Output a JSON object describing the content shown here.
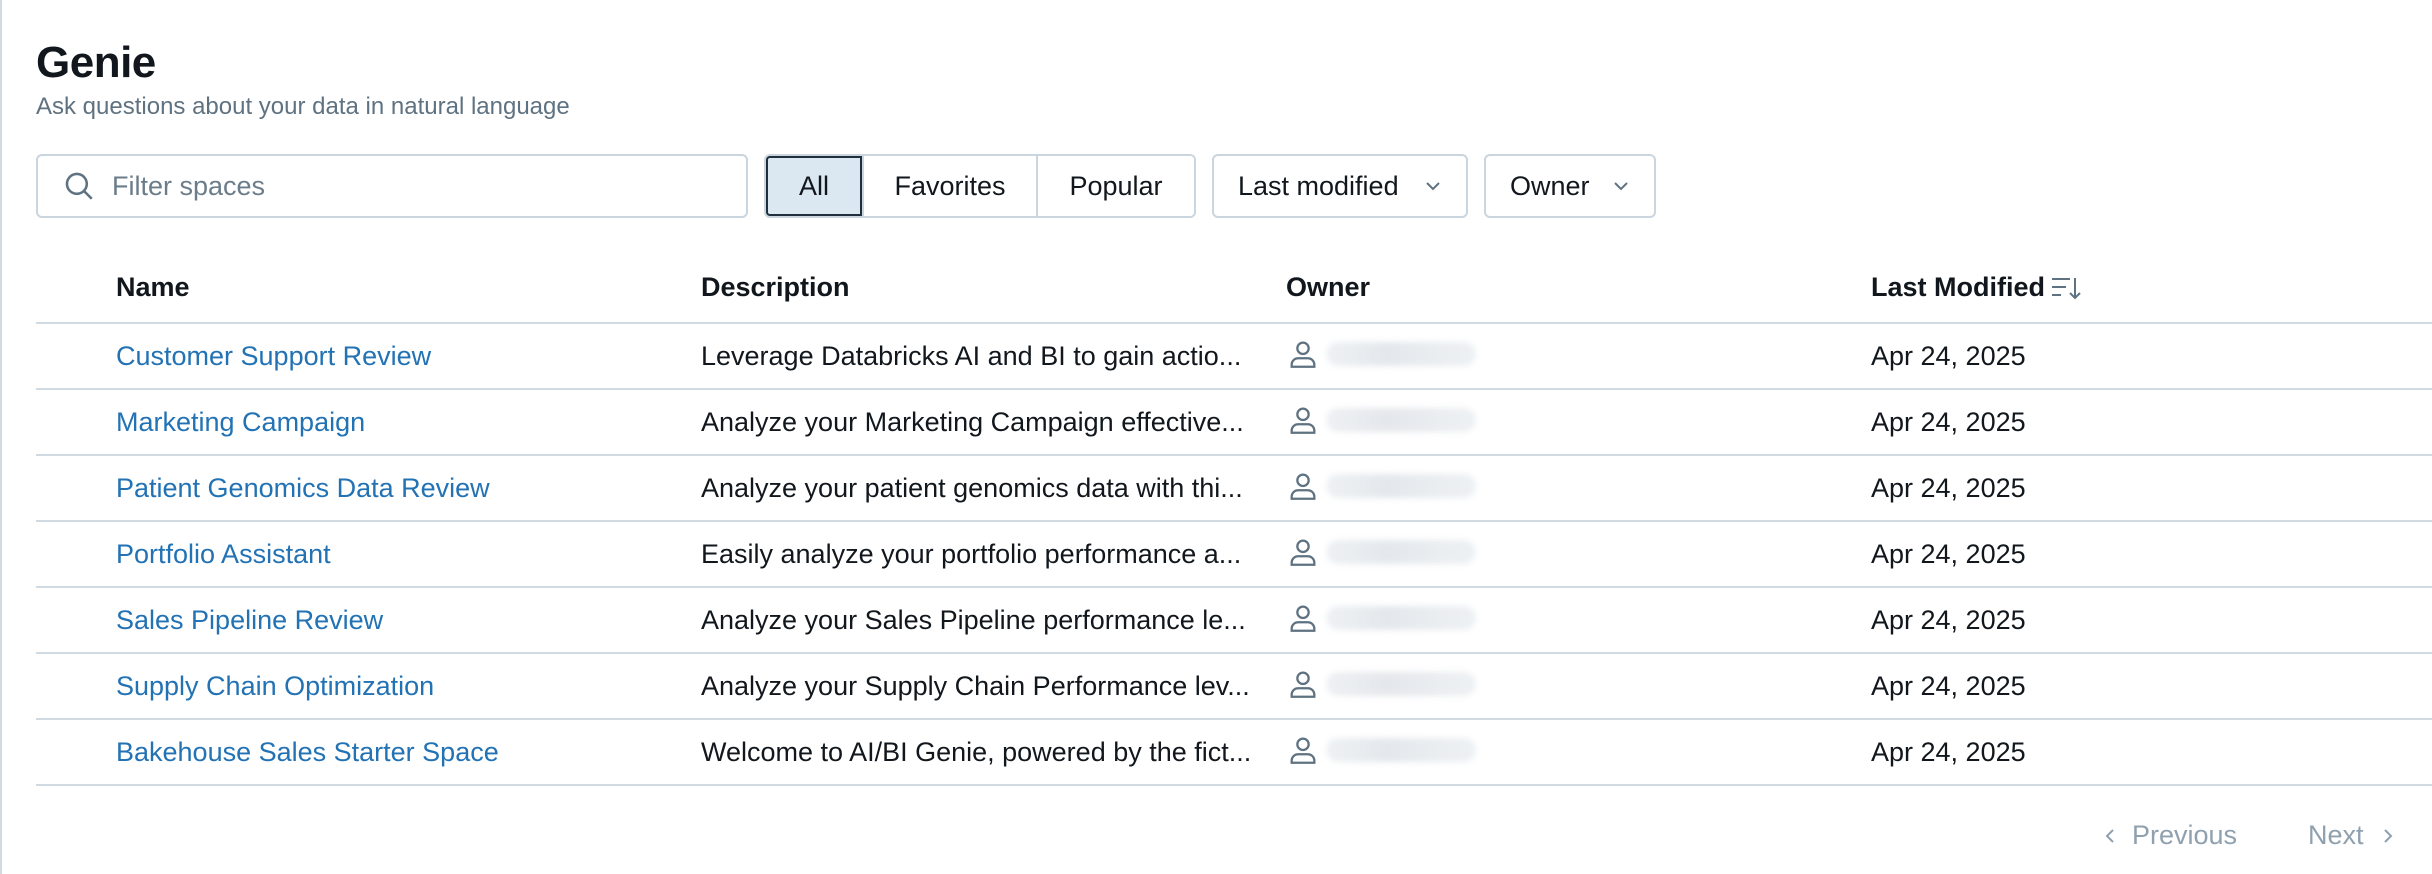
{
  "page": {
    "title": "Genie",
    "subtitle": "Ask questions about your data in natural language"
  },
  "toolbar": {
    "search_placeholder": "Filter spaces",
    "search_icon": "search-icon",
    "segments": [
      "All",
      "Favorites",
      "Popular"
    ],
    "active_segment": "All",
    "sort_dropdown": "Last modified",
    "owner_dropdown": "Owner"
  },
  "table": {
    "headers": {
      "name": "Name",
      "description": "Description",
      "owner": "Owner",
      "last_modified": "Last Modified"
    },
    "rows": [
      {
        "name": "Customer Support Review",
        "description": "Leverage Databricks AI and BI to gain actio...",
        "last_modified": "Apr 24, 2025"
      },
      {
        "name": "Marketing Campaign",
        "description": "Analyze your Marketing Campaign effective...",
        "last_modified": "Apr 24, 2025"
      },
      {
        "name": "Patient Genomics Data Review",
        "description": "Analyze your patient genomics data with thi...",
        "last_modified": "Apr 24, 2025"
      },
      {
        "name": "Portfolio Assistant",
        "description": "Easily analyze your portfolio performance a...",
        "last_modified": "Apr 24, 2025"
      },
      {
        "name": "Sales Pipeline Review",
        "description": "Analyze your Sales Pipeline performance le...",
        "last_modified": "Apr 24, 2025"
      },
      {
        "name": "Supply Chain Optimization",
        "description": "Analyze your Supply Chain Performance lev...",
        "last_modified": "Apr 24, 2025"
      },
      {
        "name": "Bakehouse Sales Starter Space",
        "description": "Welcome to AI/BI Genie, powered by the fict...",
        "last_modified": "Apr 24, 2025"
      }
    ]
  },
  "pagination": {
    "previous": "Previous",
    "next": "Next"
  },
  "colors": {
    "link": "#2272b4",
    "active_segment_bg": "#dbe7f1",
    "border": "#cbd5de",
    "muted": "#5f7281"
  }
}
